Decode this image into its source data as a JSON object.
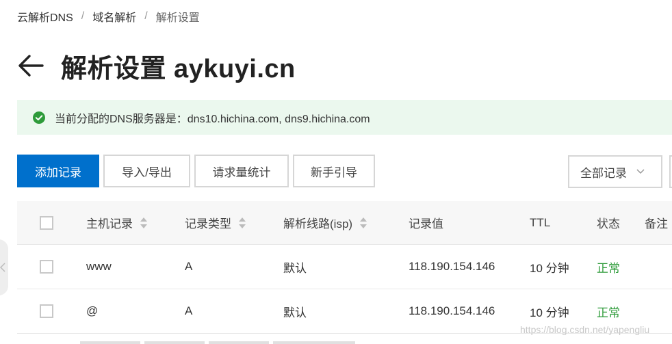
{
  "breadcrumb": {
    "items": [
      "云解析DNS",
      "域名解析"
    ],
    "separator": "/",
    "current": "解析设置"
  },
  "header": {
    "back_icon": "arrow-left-icon",
    "title": "解析设置 aykuyi.cn"
  },
  "dns_banner": {
    "icon": "check-circle-icon",
    "text": "当前分配的DNS服务器是：dns10.hichina.com, dns9.hichina.com"
  },
  "toolbar": {
    "add_record": "添加记录",
    "import_export": "导入/导出",
    "request_stats": "请求量统计",
    "beginner_guide": "新手引导",
    "filter_value": "全部记录"
  },
  "table": {
    "columns": {
      "host": "主机记录",
      "type": "记录类型",
      "line": "解析线路(isp)",
      "value": "记录值",
      "ttl": "TTL",
      "status": "状态",
      "note": "备注"
    },
    "rows": [
      {
        "host": "www",
        "type": "A",
        "line": "默认",
        "value": "118.190.154.146",
        "ttl": "10 分钟",
        "status": "正常"
      },
      {
        "host": "@",
        "type": "A",
        "line": "默认",
        "value": "118.190.154.146",
        "ttl": "10 分钟",
        "status": "正常"
      }
    ]
  },
  "watermark": "https://blog.csdn.net/yapengliu",
  "colors": {
    "primary": "#0070cc",
    "success": "#2e9b3a",
    "banner_bg": "#ebf8ee",
    "header_bg": "#f7f7f7"
  }
}
